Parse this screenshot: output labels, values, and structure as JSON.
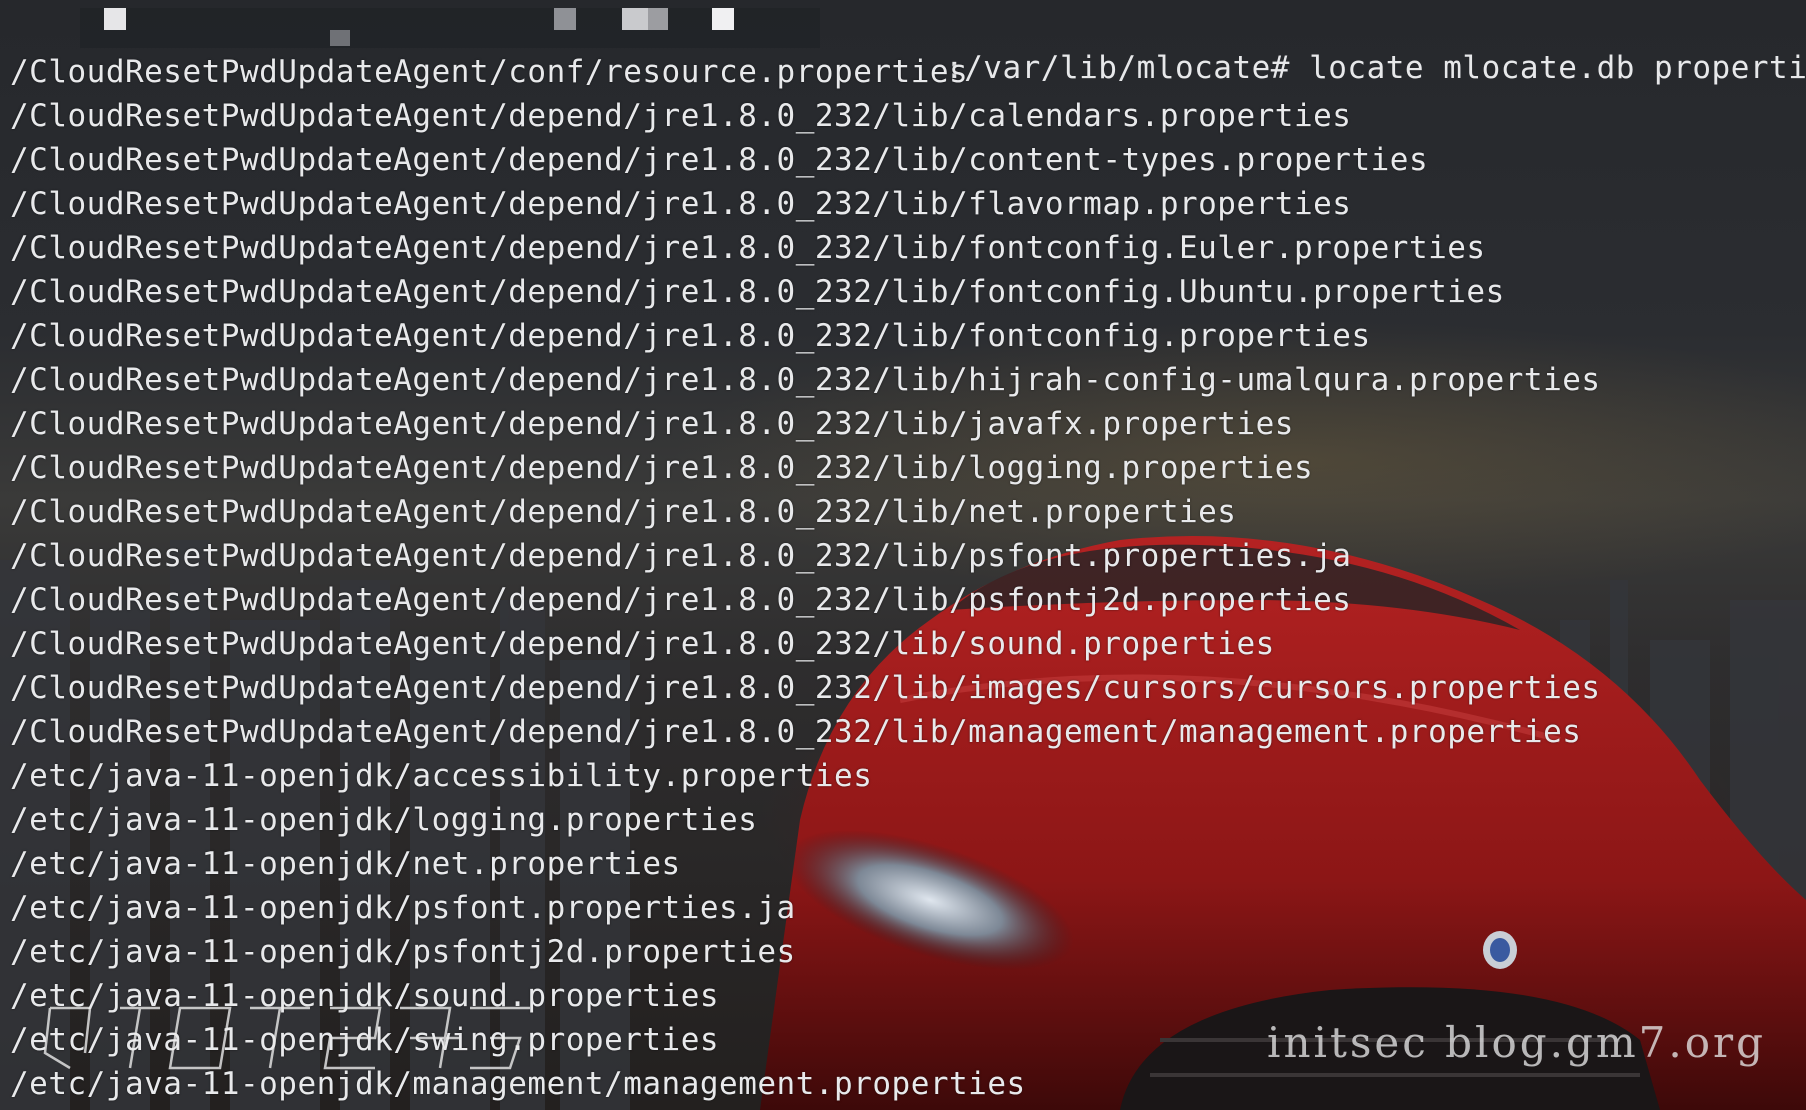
{
  "terminal": {
    "prompt": {
      "path": ":/var/lib/mlocate#",
      "command": "locate mlocate.db properties"
    },
    "output_lines": [
      "/CloudResetPwdUpdateAgent/conf/resource.properties",
      "/CloudResetPwdUpdateAgent/depend/jre1.8.0_232/lib/calendars.properties",
      "/CloudResetPwdUpdateAgent/depend/jre1.8.0_232/lib/content-types.properties",
      "/CloudResetPwdUpdateAgent/depend/jre1.8.0_232/lib/flavormap.properties",
      "/CloudResetPwdUpdateAgent/depend/jre1.8.0_232/lib/fontconfig.Euler.properties",
      "/CloudResetPwdUpdateAgent/depend/jre1.8.0_232/lib/fontconfig.Ubuntu.properties",
      "/CloudResetPwdUpdateAgent/depend/jre1.8.0_232/lib/fontconfig.properties",
      "/CloudResetPwdUpdateAgent/depend/jre1.8.0_232/lib/hijrah-config-umalqura.properties",
      "/CloudResetPwdUpdateAgent/depend/jre1.8.0_232/lib/javafx.properties",
      "/CloudResetPwdUpdateAgent/depend/jre1.8.0_232/lib/logging.properties",
      "/CloudResetPwdUpdateAgent/depend/jre1.8.0_232/lib/net.properties",
      "/CloudResetPwdUpdateAgent/depend/jre1.8.0_232/lib/psfont.properties.ja",
      "/CloudResetPwdUpdateAgent/depend/jre1.8.0_232/lib/psfontj2d.properties",
      "/CloudResetPwdUpdateAgent/depend/jre1.8.0_232/lib/sound.properties",
      "/CloudResetPwdUpdateAgent/depend/jre1.8.0_232/lib/images/cursors/cursors.properties",
      "/CloudResetPwdUpdateAgent/depend/jre1.8.0_232/lib/management/management.properties",
      "/etc/java-11-openjdk/accessibility.properties",
      "/etc/java-11-openjdk/logging.properties",
      "/etc/java-11-openjdk/net.properties",
      "/etc/java-11-openjdk/psfont.properties.ja",
      "/etc/java-11-openjdk/psfontj2d.properties",
      "/etc/java-11-openjdk/sound.properties",
      "/etc/java-11-openjdk/swing.properties",
      "/etc/java-11-openjdk/management/management.properties"
    ]
  },
  "watermark": {
    "text": "initsec blog.gm7.org"
  },
  "colors": {
    "text": "#e8e9eb",
    "background": "#2a2c31",
    "car_red": "#a31c1c"
  }
}
